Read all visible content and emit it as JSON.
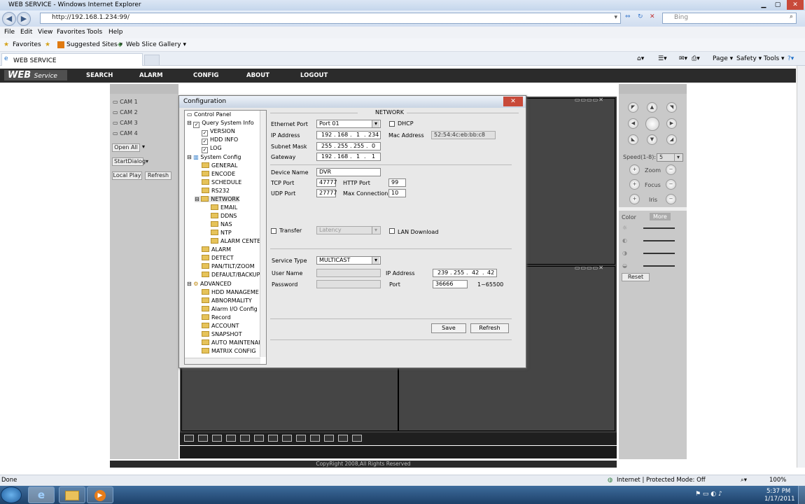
{
  "window": {
    "title": "WEB SERVICE - Windows Internet Explorer"
  },
  "browser": {
    "address": "http://192.168.1.234:99/",
    "search_placeholder": "Bing",
    "menu": [
      "File",
      "Edit",
      "View",
      "Favorites",
      "Tools",
      "Help"
    ],
    "favorites_label": "Favorites",
    "suggested_sites": "Suggested Sites ▾",
    "web_slice": "Web Slice Gallery ▾",
    "tab_title": "WEB SERVICE",
    "cmd": {
      "page": "Page ▾",
      "safety": "Safety ▾",
      "tools": "Tools ▾"
    }
  },
  "webservice": {
    "logo_main": "WEB",
    "logo_sub": "Service",
    "nav": [
      "SEARCH",
      "ALARM",
      "CONFIG",
      "ABOUT",
      "LOGOUT"
    ],
    "cams": [
      "CAM 1",
      "CAM 2",
      "CAM 3",
      "CAM 4"
    ],
    "open_all": "Open All",
    "start_dialog": "StartDialog",
    "local_play": "Local Play",
    "refresh": "Refresh",
    "copyright": "CopyRight 2008,All Rights Reserved"
  },
  "ptz": {
    "speed_label": "Speed(1-8):",
    "speed_value": "5",
    "zoom": "Zoom",
    "focus": "Focus",
    "iris": "Iris",
    "color_tab": "Color",
    "more_tab": "More",
    "reset": "Reset"
  },
  "dialog": {
    "title": "Configuration",
    "tree": {
      "root": "Control Panel",
      "query": "Query System Info",
      "version": "VERSION",
      "hdd": "HDD INFO",
      "log": "LOG",
      "system": "System Config",
      "general": "GENERAL",
      "encode": "ENCODE",
      "schedule": "SCHEDULE",
      "rs232": "RS232",
      "network": "NETWORK",
      "email": "EMAIL",
      "ddns": "DDNS",
      "nas": "NAS",
      "ntp": "NTP",
      "alarm_center": "ALARM CENTE",
      "alarm": "ALARM",
      "detect": "DETECT",
      "ptz": "PAN/TILT/ZOOM",
      "default_backup": "DEFAULT/BACKUP",
      "advanced": "ADVANCED",
      "hdd_manage": "HDD MANAGEME",
      "abnormality": "ABNORMALITY",
      "alarm_io": "Alarm I/O Config",
      "record": "Record",
      "account": "ACCOUNT",
      "snapshot": "SNAPSHOT",
      "auto_maint": "AUTO MAINTENAI",
      "matrix": "MATRIX CONFIG"
    },
    "network": {
      "section": "NETWORK",
      "ethernet_port_label": "Ethernet Port",
      "ethernet_port": "Port 01",
      "dhcp": "DHCP",
      "ip_label": "IP Address",
      "ip": [
        "192",
        "168",
        "1",
        "234"
      ],
      "mac_label": "Mac Address",
      "mac": "52:54:4c:eb:bb:c8",
      "subnet_label": "Subnet Mask",
      "subnet": [
        "255",
        "255",
        "255",
        "0"
      ],
      "gateway_label": "Gateway",
      "gateway": [
        "192",
        "168",
        "1",
        "1"
      ],
      "device_name_label": "Device Name",
      "device_name": "DVR",
      "tcp_label": "TCP Port",
      "tcp": "47777",
      "http_label": "HTTP Port",
      "http": "99",
      "udp_label": "UDP Port",
      "udp": "27777",
      "maxconn_label": "Max Connection",
      "maxconn": "10",
      "transfer": "Transfer",
      "latency": "Latency",
      "lan_download": "LAN Download",
      "service_type_label": "Service Type",
      "service_type": "MULTICAST",
      "user_label": "User Name",
      "password_label": "Password",
      "mc_ip_label": "IP Address",
      "mc_ip": [
        "239",
        "255",
        "42",
        "42"
      ],
      "port_label": "Port",
      "port": "36666",
      "port_range": "1~65500",
      "save": "Save",
      "refresh": "Refresh"
    }
  },
  "status": {
    "done": "Done",
    "zone": "Internet | Protected Mode: Off",
    "zoom": "100%"
  },
  "clock": {
    "time": "5:37 PM",
    "date": "1/17/2011"
  }
}
